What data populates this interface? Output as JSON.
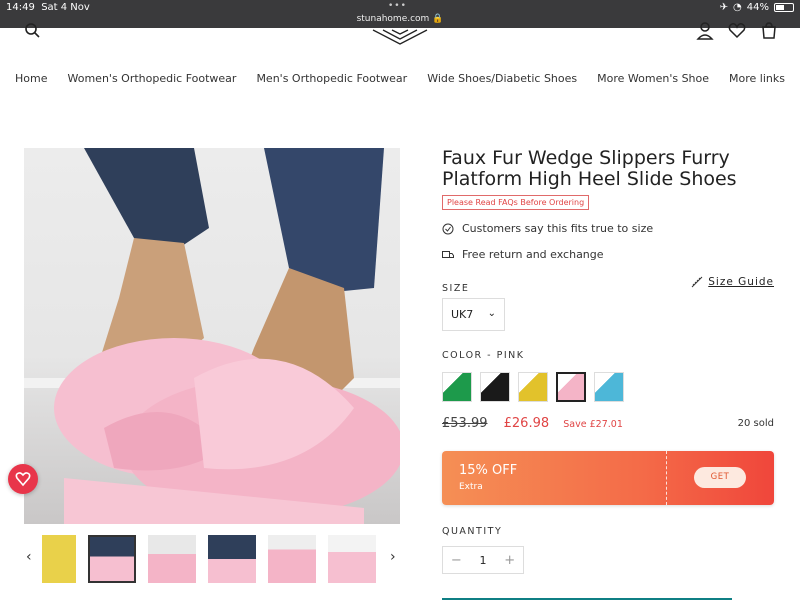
{
  "status_bar": {
    "time": "14:49",
    "date": "Sat 4 Nov",
    "url": "stunahome.com",
    "battery": "44%"
  },
  "nav": {
    "items": [
      "Home",
      "Women's Orthopedic Footwear",
      "Men's Orthopedic Footwear",
      "Wide Shoes/Diabetic Shoes",
      "More Women's Shoe",
      "More links"
    ]
  },
  "product": {
    "title": "Faux Fur Wedge Slippers Furry Platform High Heel Slide Shoes",
    "faq_label": "Please Read FAQs Before Ordering",
    "feature_fit": "Customers say this fits true to size",
    "feature_return": "Free return and exchange",
    "size_label": "SIZE",
    "size_guide": "Size Guide",
    "size_value": "UK7",
    "color_label": "COLOR - PINK",
    "old_price": "£53.99",
    "new_price": "£26.98",
    "save": "Save £27.01",
    "sold": "20 sold",
    "coupon_percent": "15% OFF",
    "coupon_extra": "Extra",
    "coupon_button": "GET",
    "quantity_label": "QUANTITY",
    "quantity_value": "1"
  },
  "colors": {
    "accent_red": "#e04545",
    "coupon_orange": "#f46b48",
    "pink": "#f4b8c8",
    "teal": "#0f7f84"
  },
  "swatches": [
    "green",
    "black",
    "yellow",
    "pink",
    "blue"
  ],
  "icons": [
    "search-icon",
    "user-icon",
    "heart-icon",
    "cart-icon",
    "check-badge-icon",
    "truck-icon",
    "ruler-icon",
    "chevron-down-icon",
    "minus-icon",
    "plus-icon",
    "chevron-left-icon",
    "chevron-right-icon"
  ]
}
